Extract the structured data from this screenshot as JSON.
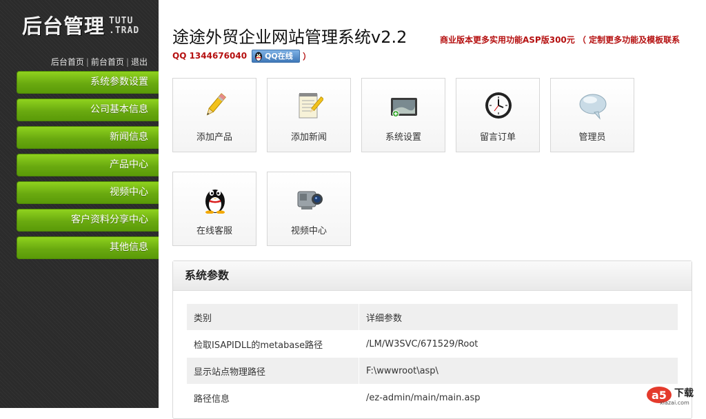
{
  "sidebar": {
    "logo": {
      "main": "后台管理",
      "sub_line1": "TUTU",
      "sub_line2": ".TRAD"
    },
    "toplinks": [
      "后台首页",
      "前台首页",
      "退出"
    ],
    "menu": [
      "系统参数设置",
      "公司基本信息",
      "新闻信息",
      "产品中心",
      "视频中心",
      "客户资料分享中心",
      "其他信息"
    ]
  },
  "header": {
    "title": "途途外贸企业网站管理系统v2.2",
    "promo": "商业版本更多实用功能ASP版300元 （ 定制更多功能及模板联系",
    "qq_label": "QQ 1344676040",
    "qq_badge": "QQ在线",
    "qq_close": "）"
  },
  "tiles": [
    {
      "label": "添加产品",
      "icon": "pencil-icon"
    },
    {
      "label": "添加新闻",
      "icon": "notepad-icon"
    },
    {
      "label": "系统设置",
      "icon": "monitor-icon"
    },
    {
      "label": "留言订单",
      "icon": "clock-icon"
    },
    {
      "label": "管理员",
      "icon": "chat-bubble-icon"
    },
    {
      "label": "在线客服",
      "icon": "qq-penguin-icon"
    },
    {
      "label": "视频中心",
      "icon": "camcorder-icon"
    }
  ],
  "panel": {
    "title": "系统参数",
    "columns": [
      "类别",
      "详细参数"
    ],
    "rows": [
      [
        "检取ISAPIDLL的metabase路径",
        "/LM/W3SVC/671529/Root"
      ],
      [
        "显示站点物理路径",
        "F:\\wwwroot\\asp\\"
      ],
      [
        "路径信息",
        "/ez-admin/main/main.asp"
      ]
    ]
  },
  "watermark": {
    "logo": "a5",
    "text": "下载",
    "url": "xiazai.com"
  },
  "colors": {
    "menu_green": "#6aaa10",
    "promo_red": "#b51010",
    "sidebar_bg": "#2b2b2b"
  }
}
